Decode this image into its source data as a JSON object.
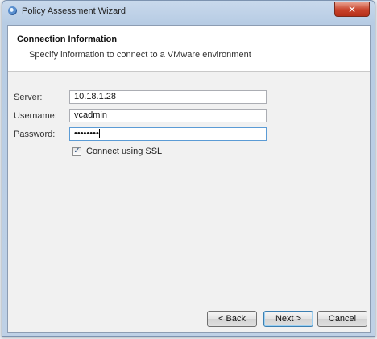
{
  "window": {
    "title": "Policy Assessment Wizard",
    "close_glyph": "✕",
    "app_icon": "wizard-icon"
  },
  "header": {
    "title": "Connection Information",
    "subtitle": "Specify information to connect to a VMware environment"
  },
  "form": {
    "server": {
      "label": "Server:",
      "value": "10.18.1.28"
    },
    "username": {
      "label": "Username:",
      "value": "vcadmin"
    },
    "password": {
      "label": "Password:",
      "value": "••••••••"
    },
    "ssl": {
      "label": "Connect using SSL",
      "checked": true,
      "check_glyph": "✓"
    }
  },
  "buttons": {
    "back": "< Back",
    "next": "Next >",
    "cancel": "Cancel"
  },
  "colors": {
    "close_button": "#c8422a",
    "window_frame": "#b7cce4",
    "default_button_border": "#3c7fb1"
  }
}
